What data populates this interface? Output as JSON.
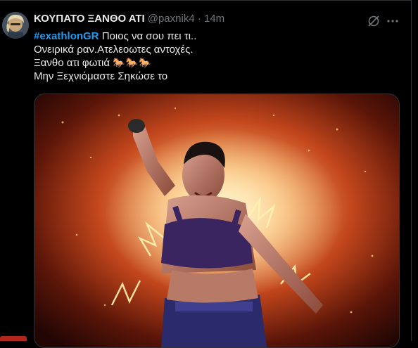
{
  "tweet": {
    "display_name": "ΚΟΥΠΑΤΟ ΞΑΝΘΟ ΑΤΙ",
    "handle_time": "@paxnik4 · 14m",
    "hashtag": "#exathlonGR",
    "line1_rest": " Ποιος να σου πει τι..",
    "line2": "Ονειρικά ραν.Ατελεοωτες αντοχές.",
    "line3": "Ξανθο ατι φωτιά",
    "line3_emoji": "🐎🐎🐎",
    "line4": "Μην Ξεχνιόμαστε Σηκώσε το"
  },
  "icons": {
    "grok": "grok-icon",
    "more": "more-options-icon"
  },
  "colors": {
    "background": "#000000",
    "text": "#e7e9ea",
    "muted": "#71767b",
    "hashtag": "#1d9bf0",
    "divider": "#2f3336"
  }
}
